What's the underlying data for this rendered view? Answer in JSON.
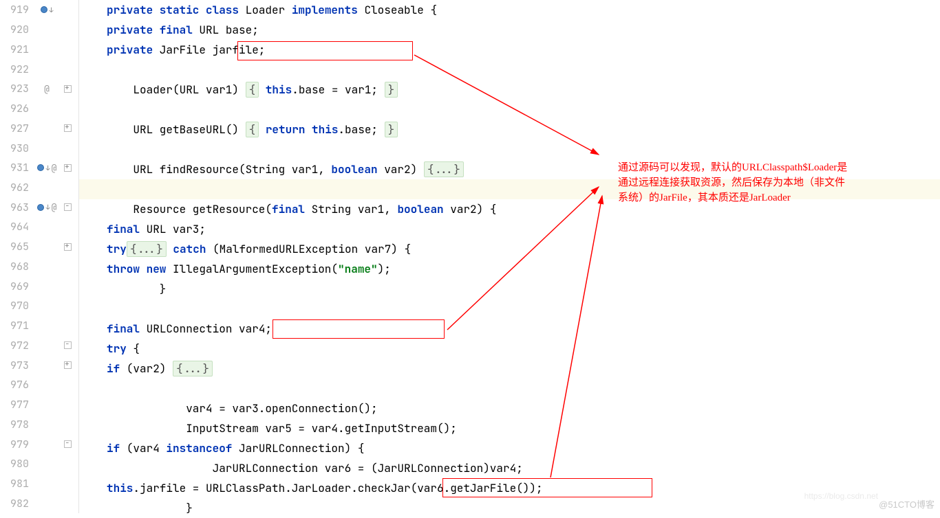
{
  "gutter": [
    {
      "n": "919",
      "marker": "o↓",
      "fold": ""
    },
    {
      "n": "920",
      "marker": "",
      "fold": ""
    },
    {
      "n": "921",
      "marker": "",
      "fold": ""
    },
    {
      "n": "922",
      "marker": "",
      "fold": ""
    },
    {
      "n": "923",
      "marker": "@",
      "fold": "plus"
    },
    {
      "n": "926",
      "marker": "",
      "fold": ""
    },
    {
      "n": "927",
      "marker": "",
      "fold": "plus"
    },
    {
      "n": "930",
      "marker": "",
      "fold": ""
    },
    {
      "n": "931",
      "marker": "o↓ @",
      "fold": "plus"
    },
    {
      "n": "962",
      "marker": "",
      "fold": ""
    },
    {
      "n": "963",
      "marker": "o↓ @",
      "fold": "minus"
    },
    {
      "n": "964",
      "marker": "",
      "fold": ""
    },
    {
      "n": "965",
      "marker": "",
      "fold": "plus"
    },
    {
      "n": "968",
      "marker": "",
      "fold": ""
    },
    {
      "n": "969",
      "marker": "",
      "fold": ""
    },
    {
      "n": "970",
      "marker": "",
      "fold": ""
    },
    {
      "n": "971",
      "marker": "",
      "fold": ""
    },
    {
      "n": "972",
      "marker": "",
      "fold": "minus"
    },
    {
      "n": "973",
      "marker": "",
      "fold": "plus"
    },
    {
      "n": "976",
      "marker": "",
      "fold": ""
    },
    {
      "n": "977",
      "marker": "",
      "fold": ""
    },
    {
      "n": "978",
      "marker": "",
      "fold": ""
    },
    {
      "n": "979",
      "marker": "",
      "fold": "minus"
    },
    {
      "n": "980",
      "marker": "",
      "fold": ""
    },
    {
      "n": "981",
      "marker": "",
      "fold": ""
    },
    {
      "n": "982",
      "marker": "",
      "fold": ""
    }
  ],
  "code": {
    "l919": {
      "pre": "",
      "k1": "private static class",
      "mid": " Loader ",
      "k2": "implements",
      "post": " Closeable {"
    },
    "l920": {
      "ind": "    ",
      "k": "private final",
      "post": " URL base;"
    },
    "l921": {
      "ind": "    ",
      "k": "private",
      "post": " JarFile jarfile;"
    },
    "l922": {
      "txt": ""
    },
    "l923": {
      "ind": "    ",
      "txt": "Loader(URL var1) ",
      "fold": "{",
      "k": " this",
      "post": ".base = var1; ",
      "fold2": "}"
    },
    "l926": {
      "txt": ""
    },
    "l927": {
      "ind": "    ",
      "txt": "URL getBaseURL() ",
      "fold": "{",
      "k": " return this",
      "post": ".base; ",
      "fold2": "}"
    },
    "l930": {
      "txt": ""
    },
    "l931": {
      "ind": "    ",
      "txt": "URL findResource(String var1, ",
      "k": "boolean",
      "post": " var2) ",
      "fold": "{...}"
    },
    "l962": {
      "txt": ""
    },
    "l963": {
      "ind": "    ",
      "txt": "Resource getResource(",
      "k": "final",
      "mid": " String var1, ",
      "k2": "boolean",
      "post": " var2) {"
    },
    "l964": {
      "ind": "        ",
      "k": "final",
      "post": " URL var3;"
    },
    "l965": {
      "ind": "        ",
      "k": "try",
      "sp": " ",
      "fold": "{...}",
      "k2": " catch",
      "post": " (MalformedURLException var7) {"
    },
    "l968": {
      "ind": "            ",
      "k": "throw new",
      "post": " IllegalArgumentException(",
      "str": "\"name\"",
      "post2": ");"
    },
    "l969": {
      "ind": "        ",
      "txt": "}"
    },
    "l970": {
      "txt": ""
    },
    "l971": {
      "ind": "        ",
      "k": "final",
      "post": " URLConnection var4;"
    },
    "l972": {
      "ind": "        ",
      "k": "try",
      "post": " {"
    },
    "l973": {
      "ind": "            ",
      "k": "if",
      "post": " (var2) ",
      "fold": "{...}"
    },
    "l976": {
      "txt": ""
    },
    "l977": {
      "ind": "            ",
      "txt": "var4 = var3.openConnection();"
    },
    "l978": {
      "ind": "            ",
      "txt": "InputStream var5 = var4.getInputStream();"
    },
    "l979": {
      "ind": "            ",
      "k": "if",
      "post": " (var4 ",
      "k2": "instanceof",
      "post2": " JarURLConnection) {"
    },
    "l980": {
      "ind": "                ",
      "txt": "JarURLConnection var6 = (JarURLConnection)var4;"
    },
    "l981": {
      "ind": "                ",
      "k": "this",
      "post": ".jarfile = URLClassPath.JarLoader.checkJar(var6.getJarFile());"
    },
    "l982": {
      "ind": "            ",
      "txt": "}"
    }
  },
  "annotation": {
    "line1": "通过源码可以发现，默认的URLClasspath$Loader是",
    "line2": "通过远程连接获取资源，然后保存为本地（非文件",
    "line3": "系统）的JarFile，其本质还是JarLoader"
  },
  "watermark": "@51CTO博客",
  "watermark2": "https://blog.csdn.net"
}
